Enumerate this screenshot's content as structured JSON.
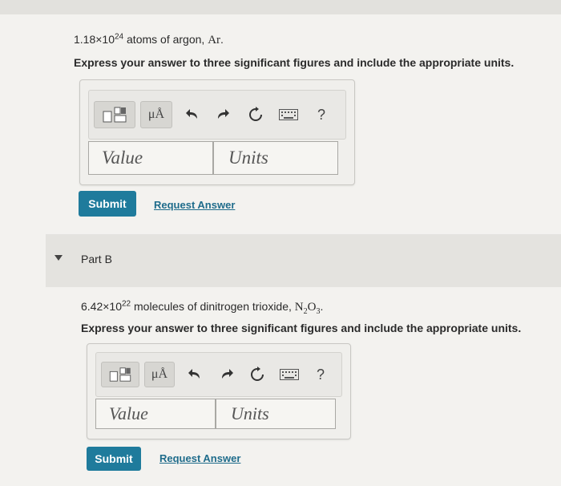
{
  "part_a": {
    "problem_number": "1.18×10",
    "problem_exponent": "24",
    "problem_rest": " atoms of argon, ",
    "problem_symbol": "Ar",
    "problem_period": ".",
    "instruction": "Express your answer to three significant figures and include the appropriate units.",
    "value_placeholder": "Value",
    "units_placeholder": "Units",
    "submit_label": "Submit",
    "request_label": "Request Answer"
  },
  "part_b": {
    "label": "Part B",
    "problem_number": "6.42×10",
    "problem_exponent": "22",
    "problem_rest": " molecules of dinitrogen trioxide, ",
    "formula_n": "N",
    "formula_n_sub": "2",
    "formula_o": "O",
    "formula_o_sub": "3",
    "problem_period": ".",
    "instruction": "Express your answer to three significant figures and include the appropriate units.",
    "value_placeholder": "Value",
    "units_placeholder": "Units",
    "submit_label": "Submit",
    "request_label": "Request Answer"
  },
  "toolbar": {
    "units_symbol": "μÅ",
    "help_symbol": "?"
  },
  "icons": [
    "template-icon",
    "undo-icon",
    "redo-icon",
    "reset-icon",
    "keyboard-icon",
    "help-icon"
  ],
  "colors": {
    "submit": "#1f7b9c",
    "link": "#1f6c8b"
  }
}
